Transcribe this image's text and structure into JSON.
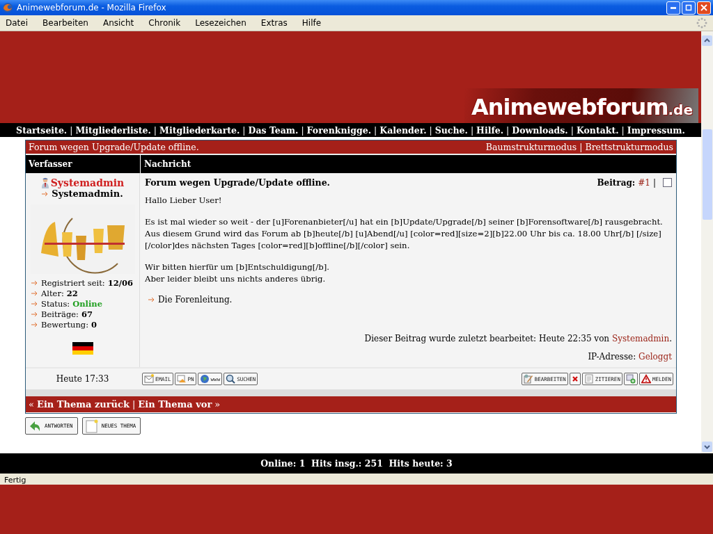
{
  "window": {
    "title": "Animewebforum.de - Mozilla Firefox"
  },
  "menu": [
    "Datei",
    "Bearbeiten",
    "Ansicht",
    "Chronik",
    "Lesezeichen",
    "Extras",
    "Hilfe"
  ],
  "logo": {
    "name": "Animewebforum",
    "suffix": ".de"
  },
  "nav": {
    "separator": "|",
    "items": [
      "Startseite.",
      "Mitgliederliste.",
      "Mitgliederkarte.",
      "Das Team.",
      "Forenknigge.",
      "Kalender.",
      "Suche.",
      "Hilfe.",
      "Downloads.",
      "Kontakt.",
      "Impressum."
    ]
  },
  "thread": {
    "title": "Forum wegen Upgrade/Update offline.",
    "views": [
      "Baumstrukturmodus",
      "Brettstrukturmodus"
    ]
  },
  "columns": [
    "Verfasser",
    "Nachricht"
  ],
  "author": {
    "name": "Systemadmin",
    "rank": "Systemadmin.",
    "stats": [
      {
        "label": "Registriert seit:",
        "value": "12/06",
        "kind": "plain"
      },
      {
        "label": "Alter:",
        "value": "22",
        "kind": "plain"
      },
      {
        "label": "Status:",
        "value": "Online",
        "kind": "status",
        "color": "#22a022"
      },
      {
        "label": "Beiträge:",
        "value": "67",
        "kind": "plain"
      },
      {
        "label": "Bewertung:",
        "value": "0",
        "kind": "plain"
      }
    ],
    "time": "Heute 17:33"
  },
  "post": {
    "title": "Forum wegen Upgrade/Update offline.",
    "number_label": "Beitrag:",
    "number": "#1",
    "separator": "|",
    "checked": false,
    "paragraphs": [
      [
        "Hallo Lieber User!"
      ],
      [
        "Es ist mal wieder so weit - der [u]Forenanbieter[/u] hat ein [b]Update/Upgrade[/b] seiner [b]Forensoftware[/b] rausgebracht. Aus diesem Grund wird das Forum ab [b]heute[/b] [u]Abend[/u] [color=red][size=2][b]22.00 Uhr bis ca. 18.00 Uhr[/b] [/size][/color]des nächsten Tages [color=red][b]offline[/b][/color] sein."
      ],
      [
        "Wir bitten hierfür um [b]Entschuldigung[/b].",
        "Aber leider bleibt uns nichts anderes übrig."
      ]
    ],
    "signature": "Die Forenleitung.",
    "edit_note": "Dieser Beitrag wurde zuletzt bearbeitet: Heute 22:35 von",
    "edit_user": "Systemadmin",
    "edit_end": ".",
    "ip_label": "IP-Adresse:",
    "ip_value": "Geloggt"
  },
  "left_buttons": [
    {
      "label": "EMAIL",
      "kind": "mail"
    },
    {
      "label": "PN",
      "kind": "pm"
    },
    {
      "label": "www",
      "kind": "web"
    },
    {
      "label": "SUCHEN",
      "kind": "search"
    }
  ],
  "right_buttons": [
    {
      "label": "BEARBEITEN",
      "kind": "edit"
    },
    {
      "kind": "delete"
    },
    {
      "label": "ZITIEREN",
      "kind": "quote"
    },
    {
      "kind": "add"
    },
    {
      "label": "MELDEN",
      "kind": "warn"
    }
  ],
  "thread_nav": {
    "prev_mark": "«",
    "prev": "Ein Thema zurück",
    "separator": "|",
    "next": "Ein Thema vor",
    "next_mark": "»"
  },
  "actions": [
    {
      "label": "ANTWORTEN",
      "kind": "reply"
    },
    {
      "label": "NEUES THEMA",
      "kind": "new"
    }
  ],
  "footer": "Online: 1  Hits insg.: 251  Hits heute: 3",
  "status_bar": "Fertig"
}
